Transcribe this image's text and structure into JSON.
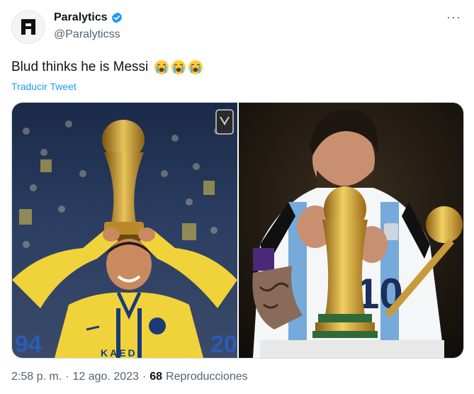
{
  "author": {
    "display_name": "Paralytics",
    "handle": "@Paralyticss",
    "avatar_letter": "A",
    "verified": true
  },
  "tweet": {
    "text": "Blud thinks he is Messi",
    "emoji_count": 3,
    "emoji": "loudly-crying-face",
    "translate_label": "Traducir Tweet"
  },
  "media": [
    {
      "name": "ronaldo-trophy-photo",
      "jersey_numbers": [
        "94",
        "20"
      ],
      "jersey_text": "KAED"
    },
    {
      "name": "messi-world-cup-photo",
      "jersey_number": "10"
    }
  ],
  "meta": {
    "time": "2:58 p. m.",
    "separator": "·",
    "date": "12 ago. 2023",
    "separator2": "·",
    "views_count": "68",
    "views_label": "Reproducciones"
  },
  "colors": {
    "link": "#1d9bf0",
    "verified": "#1d9bf0",
    "secondary_text": "#536471"
  }
}
